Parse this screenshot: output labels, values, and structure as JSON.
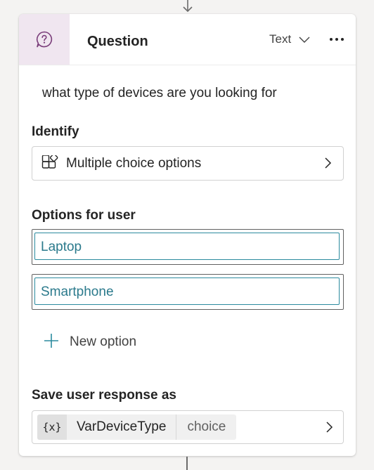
{
  "node": {
    "title": "Question",
    "type_label": "Text",
    "prompt": "what type of devices are you looking for"
  },
  "identify": {
    "label": "Identify",
    "value": "Multiple choice options"
  },
  "options": {
    "label": "Options for user",
    "items": [
      "Laptop",
      "Smartphone"
    ],
    "add_label": "New option"
  },
  "save": {
    "label": "Save user response as",
    "var_icon": "{x}",
    "var_name": "VarDeviceType",
    "var_type": "choice"
  },
  "colors": {
    "accent": "#2b8a9e",
    "header_icon_bg": "#f0e6f0",
    "header_icon": "#7a3d7a"
  },
  "icons": {
    "header": "question-bubble-icon",
    "identify": "entity-blocks-icon",
    "add": "plus-icon",
    "more": "more-horizontal-icon"
  }
}
